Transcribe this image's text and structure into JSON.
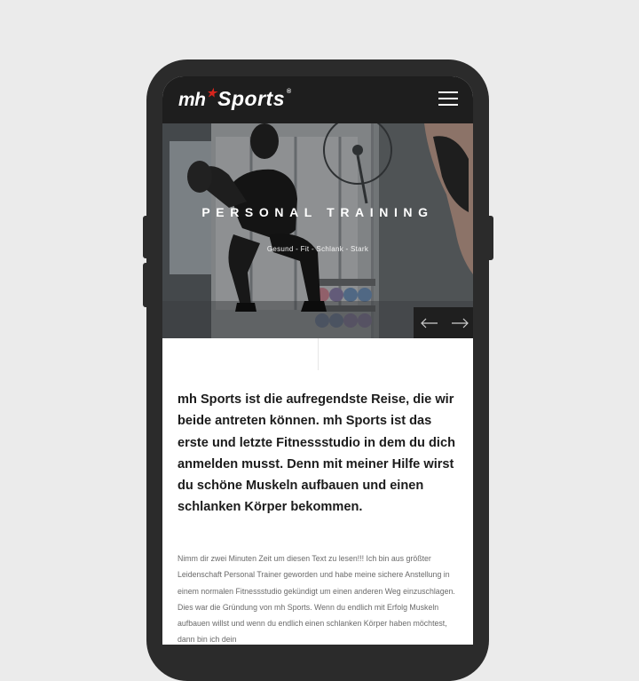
{
  "header": {
    "logo": {
      "prefix": "mh",
      "name": "Sports",
      "registered": "®"
    },
    "menu_icon": "hamburger-menu-icon"
  },
  "hero": {
    "title": "PERSONAL TRAINING",
    "subtitle": "Gesund - Fit - Schlank - Stark",
    "prev_icon": "arrow-left-icon",
    "next_icon": "arrow-right-icon"
  },
  "content": {
    "lead": "mh Sports ist die aufregendste Reise, die wir beide antreten können. mh Sports ist das erste und letzte Fitnessstudio in dem du dich anmelden musst. Denn mit meiner Hilfe wirst du schöne Muskeln aufbauen und einen schlanken Körper bekommen.",
    "body": "Nimm dir zwei Minuten Zeit um diesen Text zu lesen!!! Ich bin aus größter Leidenschaft Personal Trainer geworden und habe meine sichere Anstellung in einem normalen Fitnessstudio gekündigt um einen anderen Weg einzuschlagen. Dies war die Gründung von mh Sports. Wenn du endlich mit Erfolg Muskeln aufbauen willst und wenn du endlich einen schlanken Körper haben möchtest, dann bin ich dein"
  },
  "colors": {
    "background": "#ebebeb",
    "phone": "#2b2b2b",
    "header": "#1e1e1e",
    "logo_star": "#d7251d",
    "text": "#1c1c1c"
  }
}
